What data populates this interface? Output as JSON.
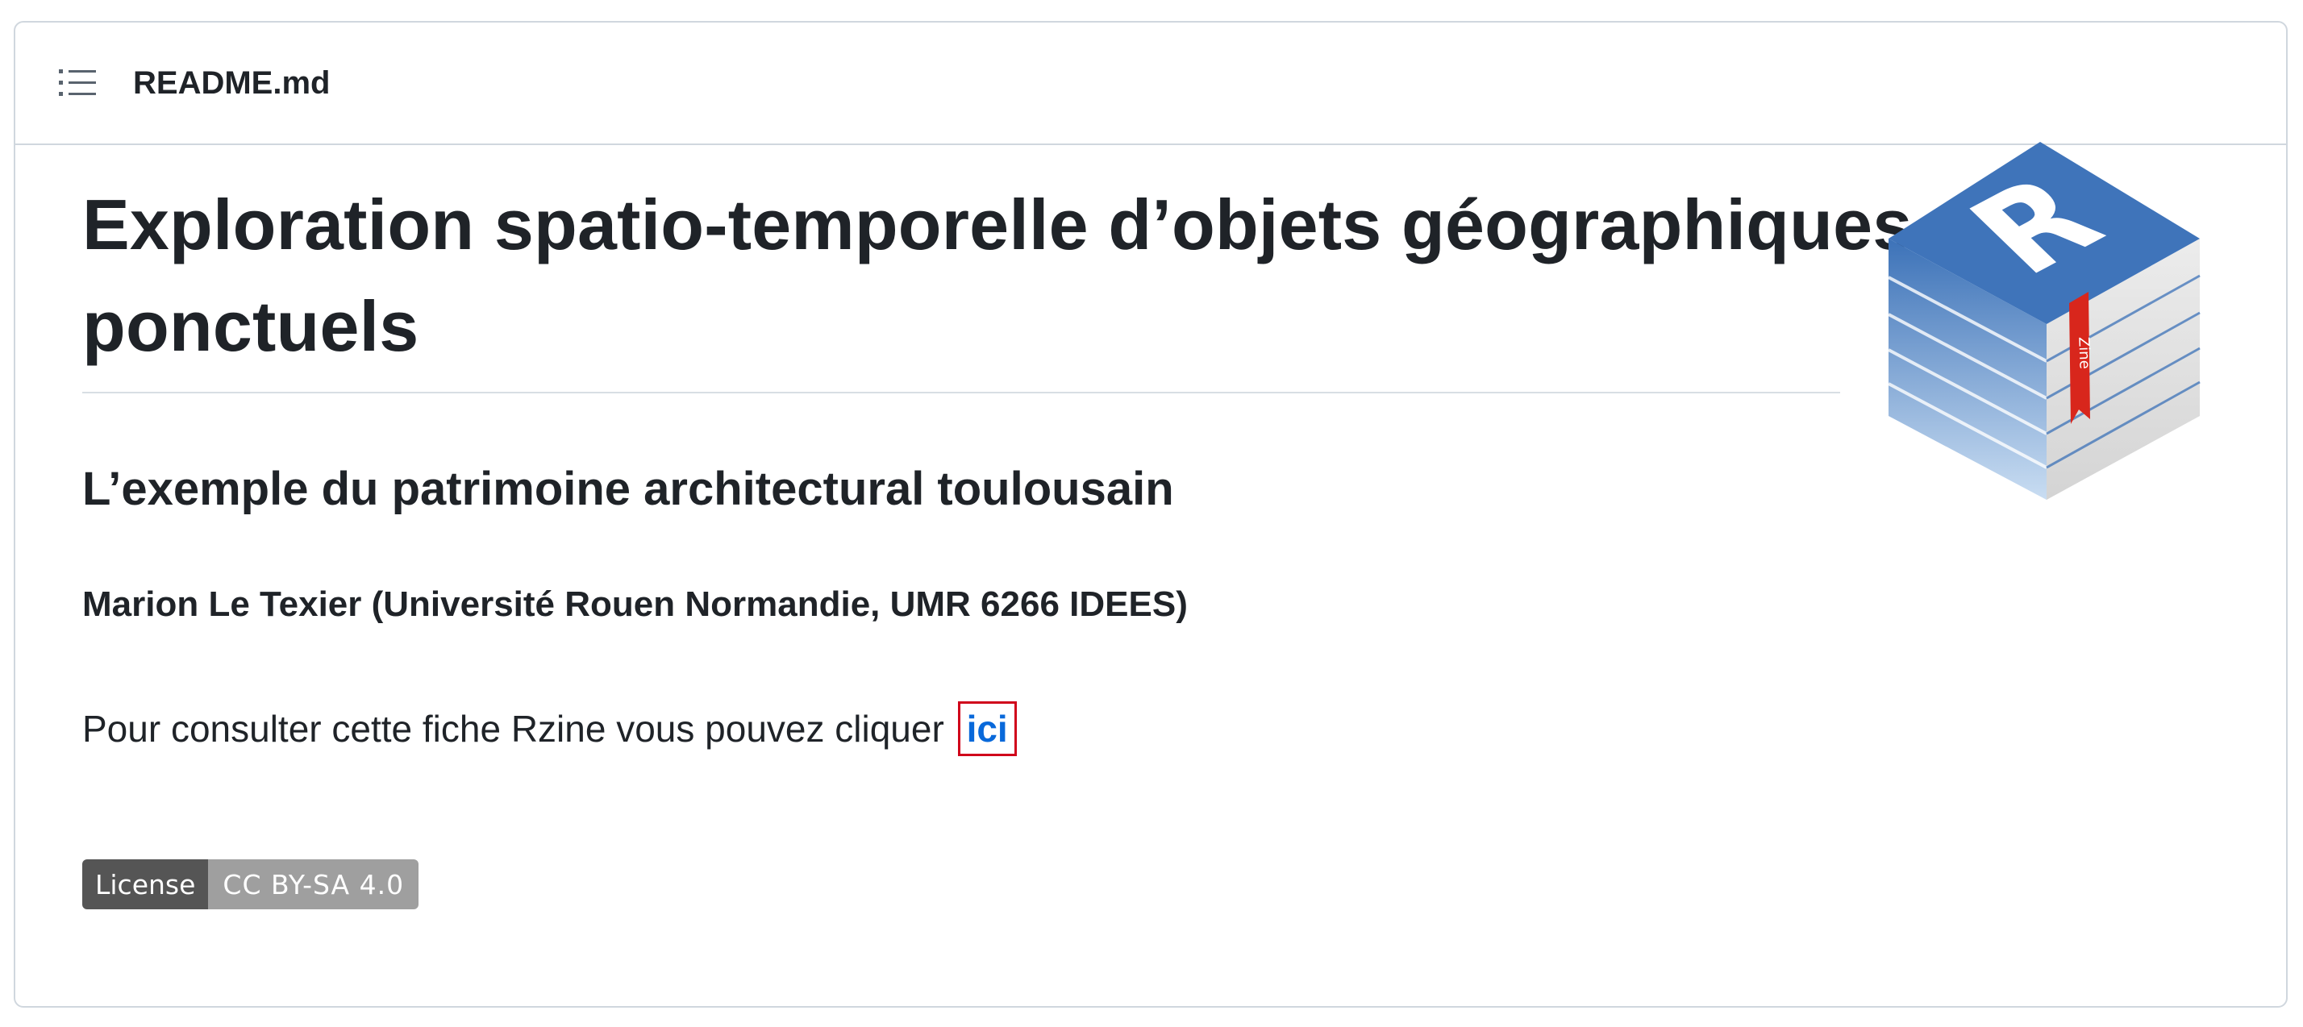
{
  "header": {
    "toc_icon": "list-unordered-icon",
    "filename": "README.md"
  },
  "readme": {
    "title": "Exploration spatio-temporelle d’objets géographiques ponctuels",
    "subtitle": "L’exemple du patrimoine architectural toulousain",
    "author": "Marion Le Texier (Université Rouen Normandie, UMR 6266 IDEES)",
    "paragraph_text": "Pour consulter cette fiche Rzine vous pouvez cliquer",
    "link_text": "ici",
    "logo": {
      "icon": "rzine-logo-icon",
      "letter": "R",
      "spine_text": "Zine"
    },
    "badge": {
      "label": "License",
      "value": "CC BY-SA 4.0"
    }
  },
  "colors": {
    "link": "#0969da",
    "highlight_border": "#d0021b",
    "badge_left": "#555555",
    "badge_right": "#9f9f9f",
    "logo_blue": "#3c72b8"
  }
}
